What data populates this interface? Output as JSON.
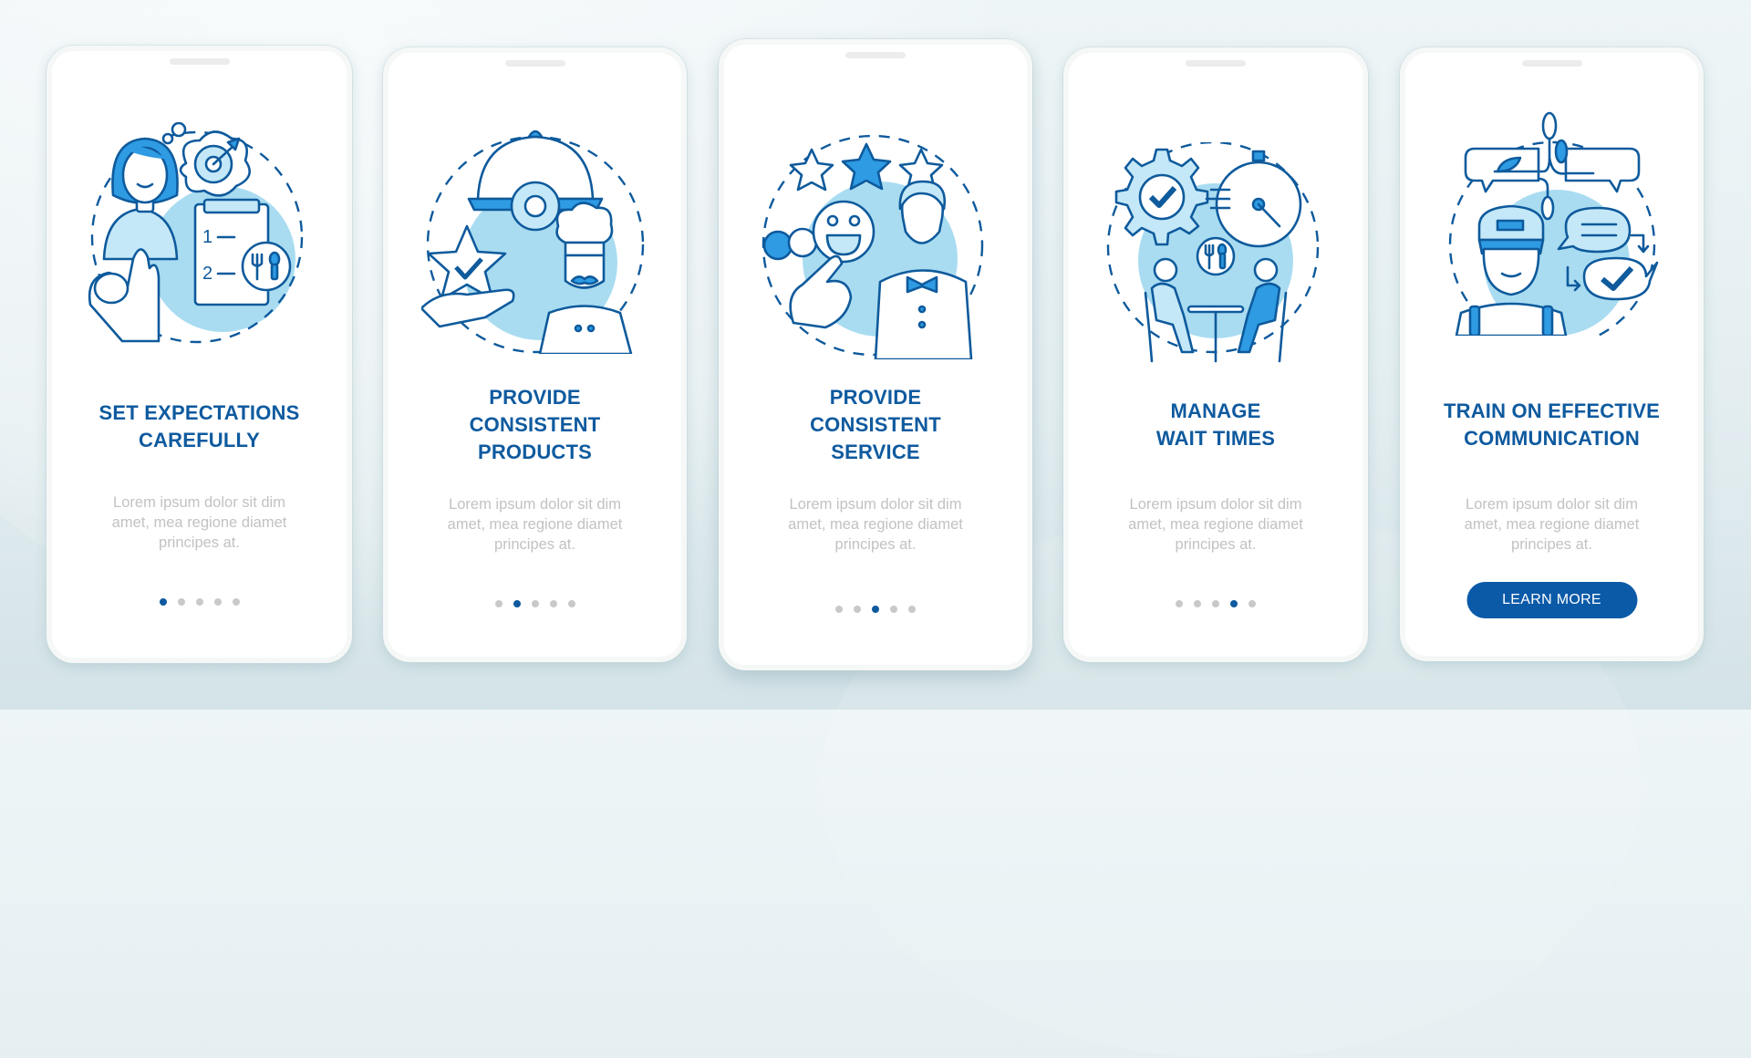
{
  "colors": {
    "accent": "#0e5a9f",
    "button": "#0b5aa8",
    "icon_fill": "#2e9be3",
    "icon_light": "#c4e8f7",
    "body_text": "#c2c2c2",
    "dot_inactive": "#c9c9c9"
  },
  "cards": [
    {
      "illustration": "set-expectations-illustration",
      "title": "SET EXPECTATIONS\nCAREFULLY",
      "body": "Lorem ipsum dolor sit dim\namet, mea regione diamet\nprincipes at.",
      "page_index": 1,
      "page_count": 5
    },
    {
      "illustration": "consistent-products-illustration",
      "title": "PROVIDE\nCONSISTENT\nPRODUCTS",
      "body": "Lorem ipsum dolor sit dim\namet, mea regione diamet\nprincipes at.",
      "page_index": 2,
      "page_count": 5
    },
    {
      "illustration": "consistent-service-illustration",
      "title": "PROVIDE\nCONSISTENT\nSERVICE",
      "body": "Lorem ipsum dolor sit dim\namet, mea regione diamet\nprincipes at.",
      "page_index": 3,
      "page_count": 5
    },
    {
      "illustration": "manage-wait-times-illustration",
      "title": "MANAGE\nWAIT TIMES",
      "body": "Lorem ipsum dolor sit dim\namet, mea regione diamet\nprincipes at.",
      "page_index": 4,
      "page_count": 5
    },
    {
      "illustration": "effective-communication-illustration",
      "title": "TRAIN ON EFFECTIVE\nCOMMUNICATION",
      "body": "Lorem ipsum dolor sit dim\namet, mea regione diamet\nprincipes at.",
      "button_label": "LEARN MORE"
    }
  ]
}
